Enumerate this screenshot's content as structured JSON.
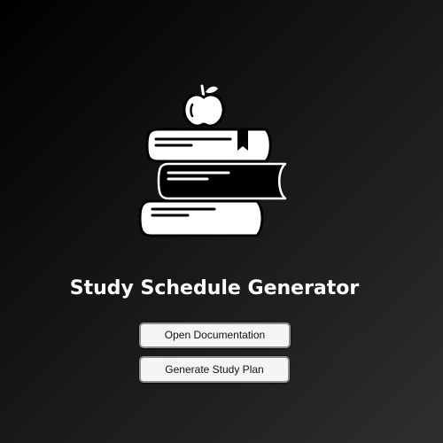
{
  "app": {
    "title": "Study Schedule Generator"
  },
  "illustration": {
    "icon": "books-with-apple-icon"
  },
  "buttons": {
    "documentation_label": "Open Documentation",
    "generate_label": "Generate Study Plan"
  }
}
